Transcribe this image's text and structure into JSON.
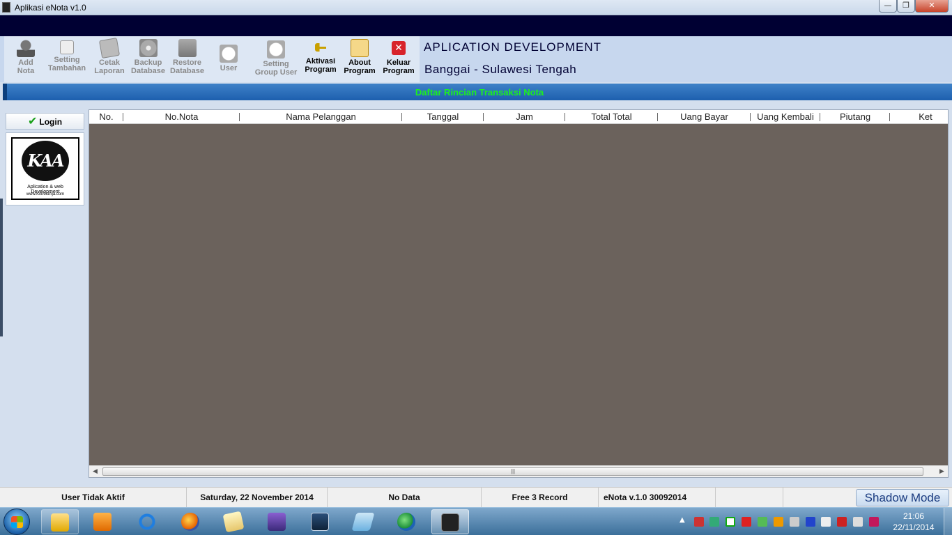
{
  "window": {
    "title": "Aplikasi eNota v1.0",
    "min_glyph": "—",
    "max_glyph": "❐",
    "close_glyph": "✕"
  },
  "toolbar": {
    "items": [
      {
        "label": "Add\nNota",
        "icon": "add-user-icon",
        "enabled": false
      },
      {
        "label": "Setting\nTambahan",
        "icon": "setting-sheet-icon",
        "enabled": false
      },
      {
        "label": "Cetak\nLaporan",
        "icon": "print-report-icon",
        "enabled": false
      },
      {
        "label": "Backup\nDatabase",
        "icon": "disc-icon",
        "enabled": false
      },
      {
        "label": "Restore\nDatabase",
        "icon": "restore-icon",
        "enabled": false
      },
      {
        "label": "User",
        "icon": "plus-circle-icon",
        "enabled": false
      },
      {
        "label": "Setting\nGroup User",
        "icon": "plus-circle-icon",
        "enabled": false
      },
      {
        "label": "Aktivasi\nProgram",
        "icon": "key-icon",
        "enabled": true
      },
      {
        "label": "About\nProgram",
        "icon": "about-icon",
        "enabled": true
      },
      {
        "label": "Keluar\nProgram",
        "icon": "exit-icon",
        "enabled": true
      }
    ]
  },
  "org": {
    "title": "APLICATION DEVELOPMENT",
    "location": "Banggai - Sulawesi Tengah"
  },
  "caption": "Daftar Rincian Transaksi Nota",
  "sidebar": {
    "login_label": "Login",
    "login_check": "✔",
    "logo": {
      "mark": "KAA",
      "tagline": "Aplication & web Development",
      "url": "www.KiliAkuAja.com"
    }
  },
  "grid": {
    "columns": [
      "No.",
      "No.Nota",
      "Nama Pelanggan",
      "Tanggal",
      "Jam",
      "Total Total",
      "Uang Bayar",
      "Uang Kembali",
      "Piutang",
      "Ket"
    ],
    "rows": [],
    "scroll_left": "◀",
    "scroll_right": "▶",
    "thumb_grip": "|||"
  },
  "status": {
    "user": "User Tidak Aktif",
    "date": "Saturday, 22 November 2014",
    "data": "No Data",
    "record": "Free 3 Record",
    "version": "eNota v.1.0 30092014",
    "shadow_mode": "Shadow Mode"
  },
  "taskbar": {
    "apps": [
      "file-explorer-icon",
      "media-player-icon",
      "internet-explorer-icon",
      "firefox-icon",
      "notepad-icon",
      "screen-app-icon",
      "window-app-icon",
      "pad-app-icon",
      "globe-app-icon",
      "enota-app-icon"
    ],
    "tray_arrow": "▲",
    "clock_time": "21:06",
    "clock_date": "22/11/2014"
  }
}
